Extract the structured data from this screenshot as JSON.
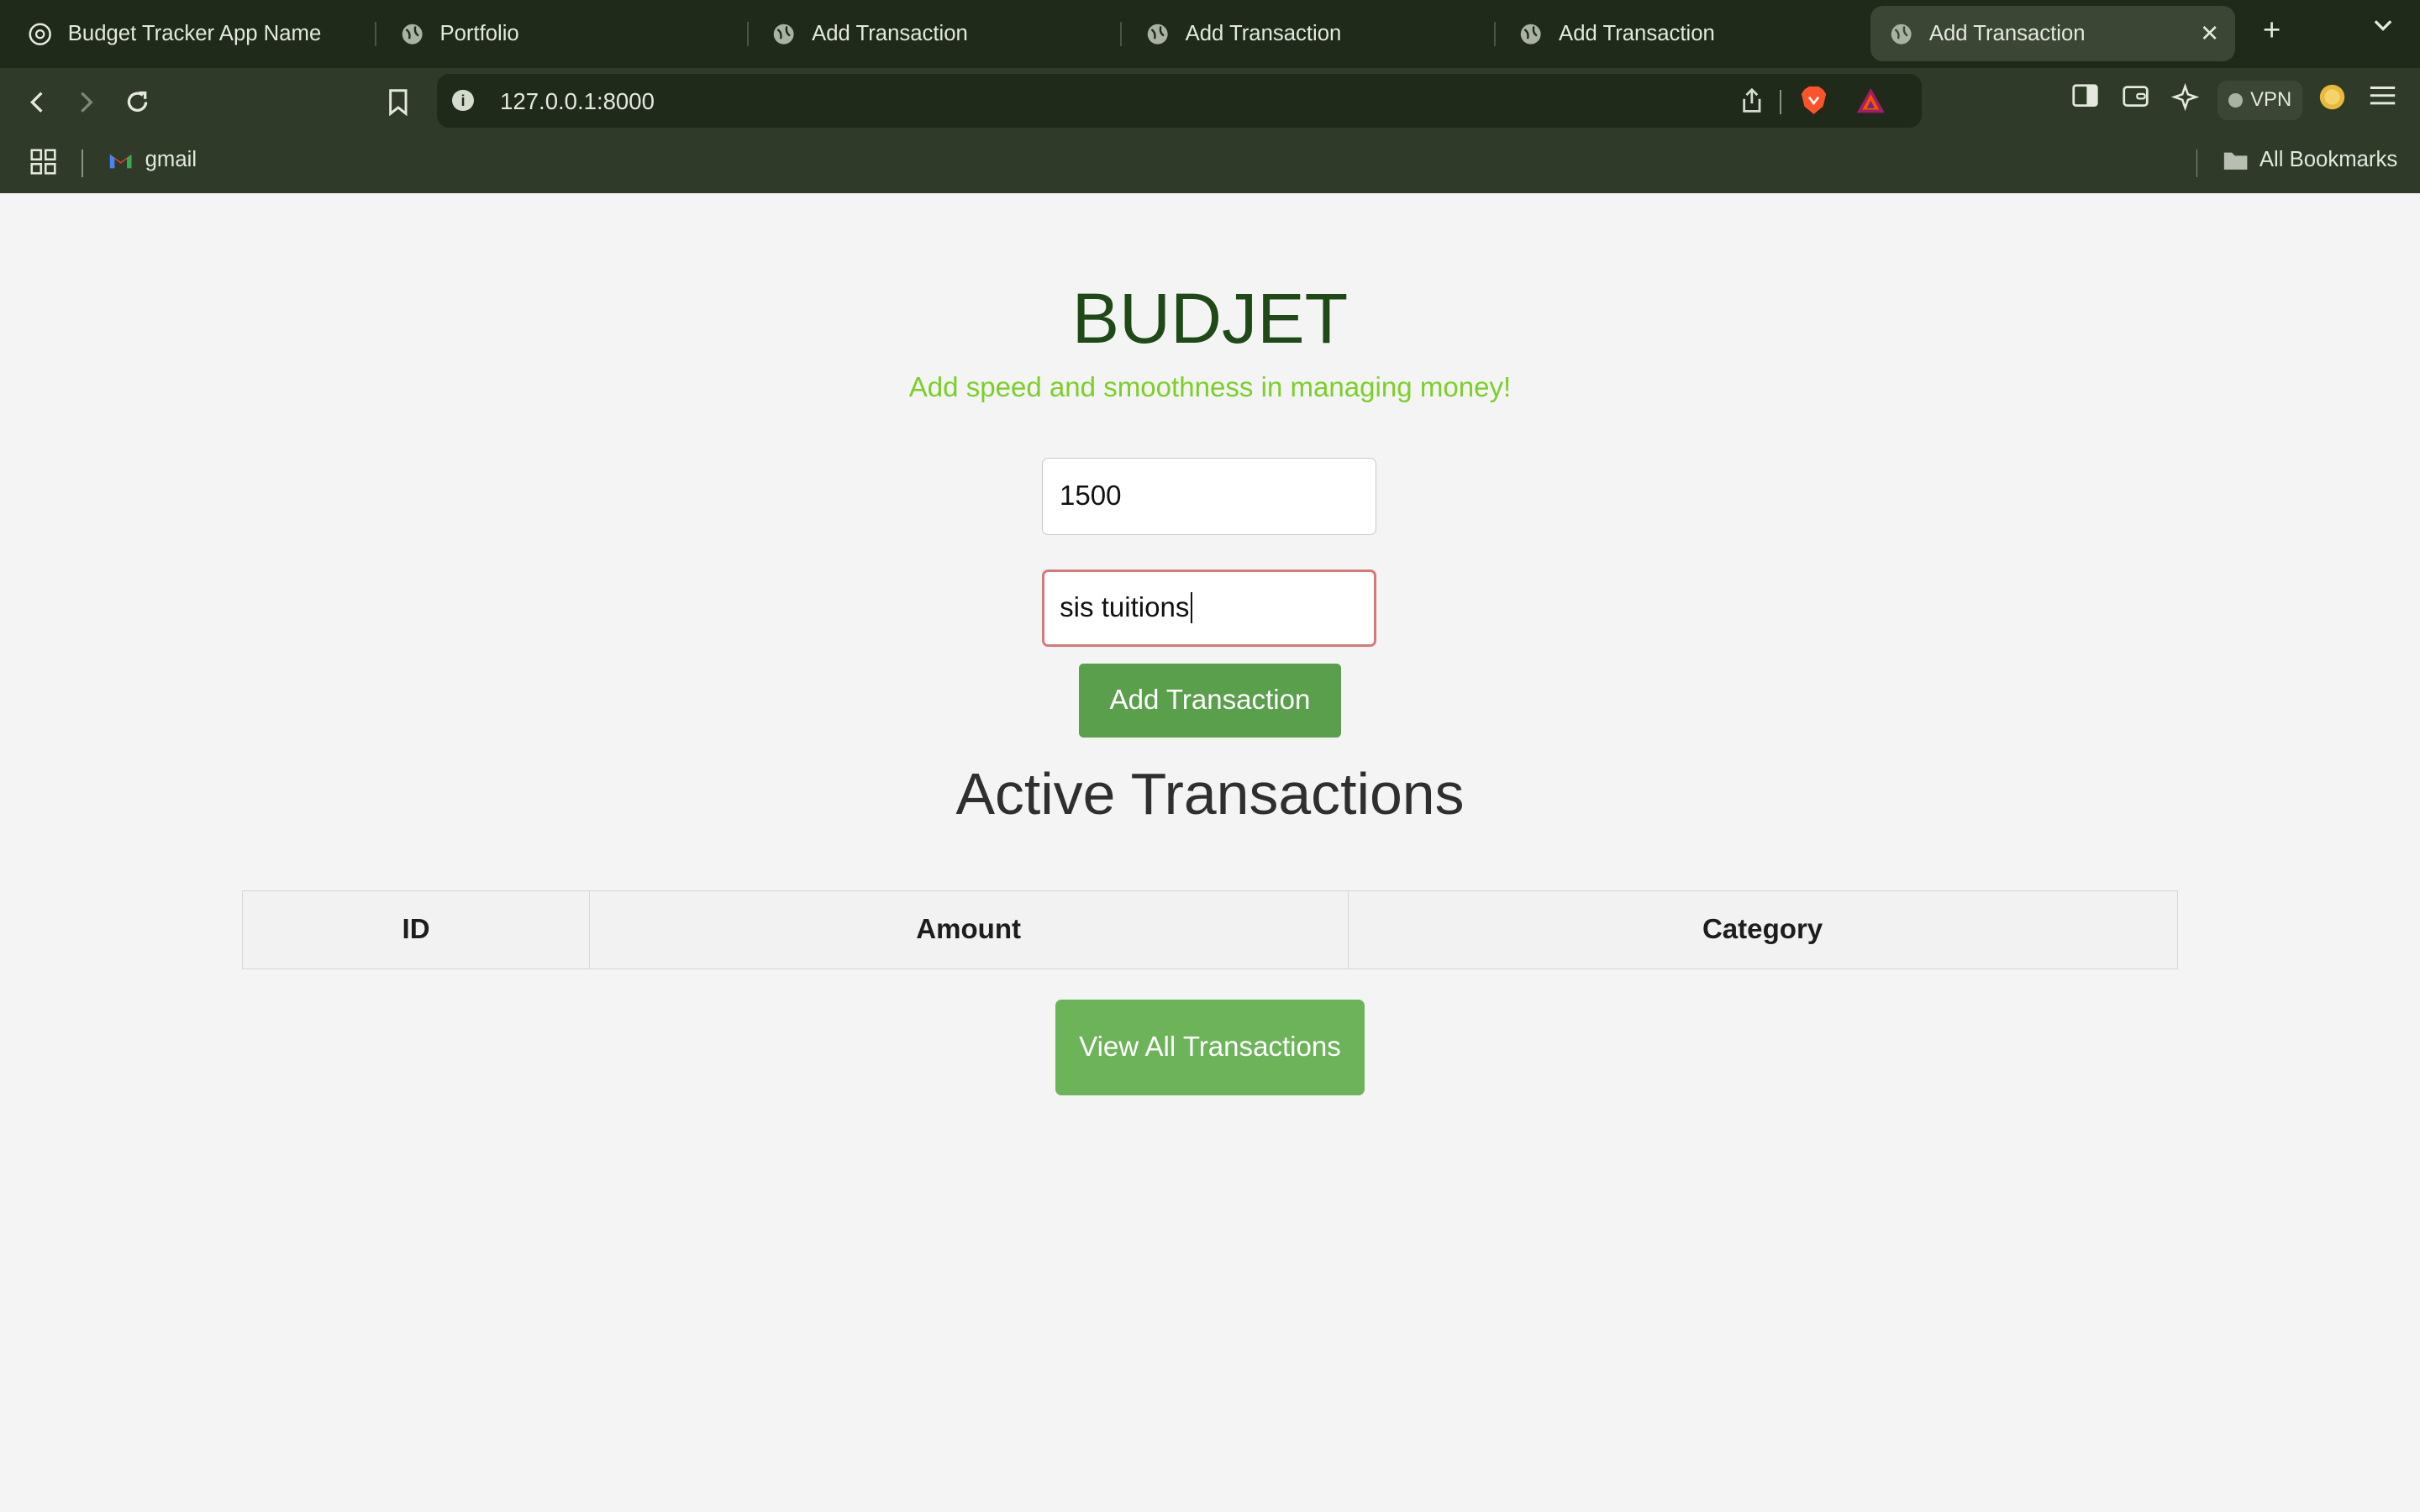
{
  "browser": {
    "tabs": [
      {
        "title": "Budget Tracker App Name",
        "icon": "openai-icon"
      },
      {
        "title": "Portfolio",
        "icon": "globe-icon"
      },
      {
        "title": "Add Transaction",
        "icon": "globe-icon"
      },
      {
        "title": "Add Transaction",
        "icon": "globe-icon"
      },
      {
        "title": "Add Transaction",
        "icon": "globe-icon"
      },
      {
        "title": "Add Transaction",
        "icon": "globe-icon",
        "active": true
      }
    ],
    "url": "127.0.0.1:8000",
    "vpn_label": "VPN",
    "bookmarks": [
      {
        "label": "gmail",
        "icon": "gmail-icon"
      }
    ],
    "all_bookmarks_label": "All Bookmarks"
  },
  "page": {
    "title": "BUDJET",
    "subtitle": "Add speed and smoothness in managing money!",
    "amount_value": "1500",
    "category_value": "sis tuitions",
    "add_button": "Add Transaction",
    "section_heading": "Active Transactions",
    "table_headers": [
      "ID",
      "Amount",
      "Category"
    ],
    "view_all_button": "View All Transactions"
  },
  "colors": {
    "title": "#1f4a17",
    "subtitle": "#7ccf2a",
    "button": "#5a9f4c",
    "browser_chrome": "#2f3a28"
  }
}
